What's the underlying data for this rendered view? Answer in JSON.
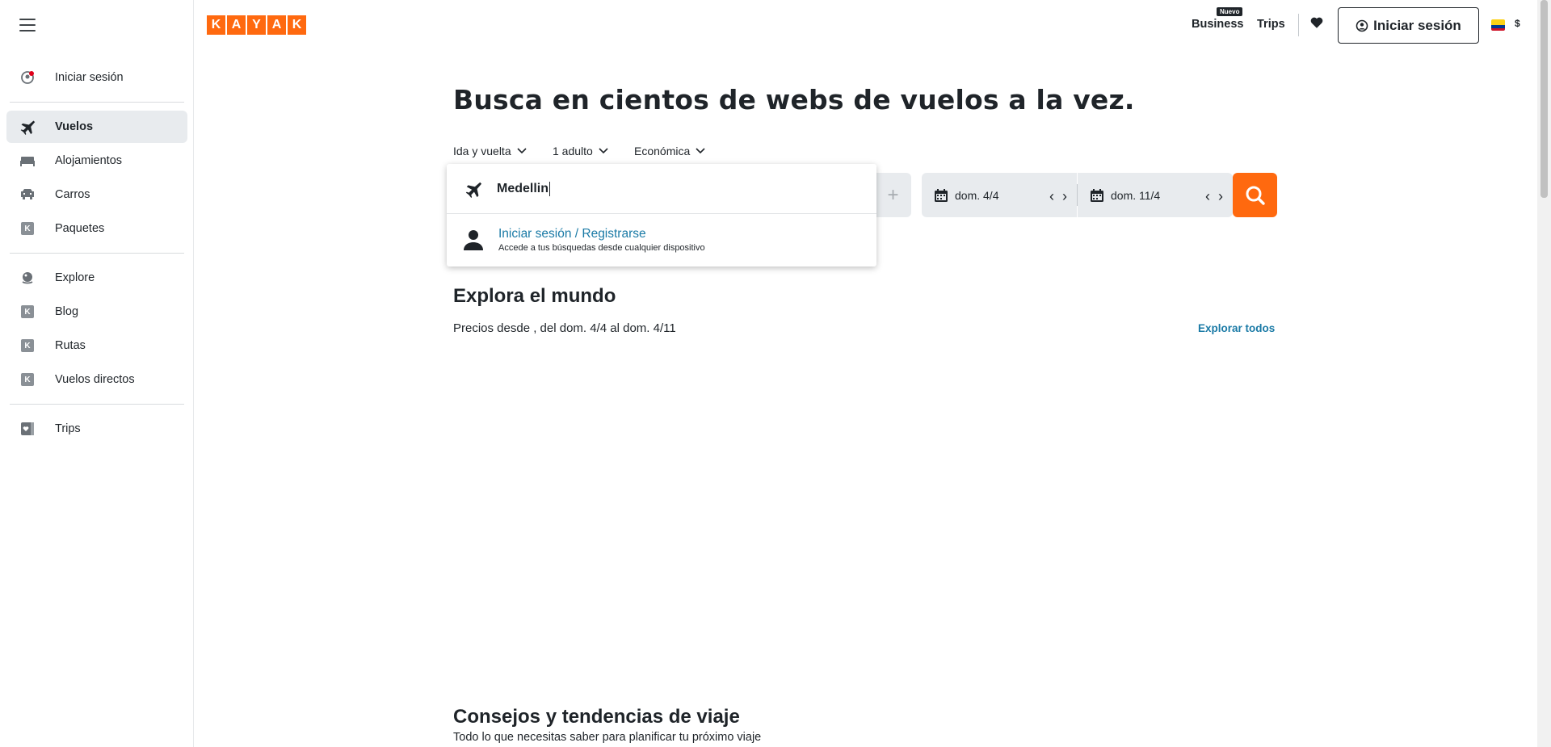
{
  "sidebar": {
    "items": [
      {
        "label": "Iniciar sesión",
        "icon": "user-circle-icon"
      },
      {
        "label": "Vuelos",
        "icon": "plane-icon"
      },
      {
        "label": "Alojamientos",
        "icon": "bed-icon"
      },
      {
        "label": "Carros",
        "icon": "car-icon"
      },
      {
        "label": "Paquetes",
        "icon": "kayak-k-icon"
      },
      {
        "label": "Explore",
        "icon": "globe-icon"
      },
      {
        "label": "Blog",
        "icon": "kayak-k-icon"
      },
      {
        "label": "Rutas",
        "icon": "kayak-k-icon"
      },
      {
        "label": "Vuelos directos",
        "icon": "kayak-k-icon"
      },
      {
        "label": "Trips",
        "icon": "trips-heart-icon"
      }
    ],
    "k_glyph": "K"
  },
  "header": {
    "logo_letters": [
      "K",
      "A",
      "Y",
      "A",
      "K"
    ],
    "business": "Business",
    "badge_new": "Nuevo",
    "trips": "Trips",
    "login": "Iniciar sesión",
    "currency": "$"
  },
  "hero": {
    "title": "Busca en cientos de webs de vuelos a la vez."
  },
  "options": {
    "trip_type": "Ida y vuelta",
    "travelers": "1 adulto",
    "cabin": "Económica"
  },
  "search": {
    "origin_value": "Medellin",
    "swap_glyph": "+",
    "depart_date": "dom. 4/4",
    "return_date": "dom. 11/4",
    "prev_glyph": "‹",
    "next_glyph": "›"
  },
  "dropdown": {
    "suggest_title": "Iniciar sesión / Registrarse",
    "suggest_sub": "Accede a tus búsquedas desde cualquier dispositivo"
  },
  "explore": {
    "title": "Explora el mundo",
    "subtitle": "Precios desde , del dom. 4/4 al dom. 4/11",
    "link": "Explorar todos"
  },
  "tips": {
    "title": "Consejos y tendencias de viaje",
    "subtitle": "Todo lo que necesitas saber para planificar tu próximo viaje"
  },
  "colors": {
    "brand": "#ff690f",
    "link": "#1a7aa6",
    "active_bg": "#e8ebee"
  }
}
